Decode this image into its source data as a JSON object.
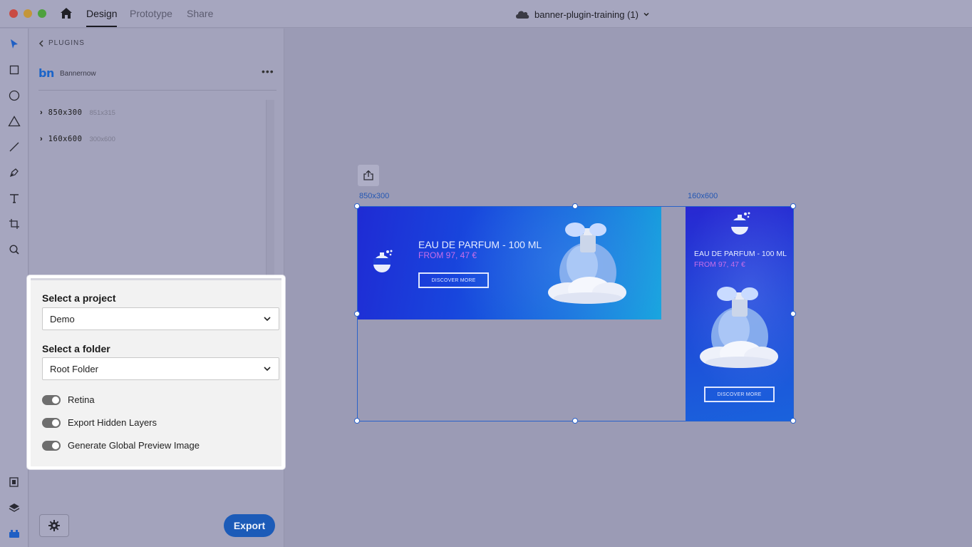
{
  "titlebar": {
    "tabs": [
      "Design",
      "Prototype",
      "Share"
    ],
    "active_tab": "Design",
    "document_title": "banner-plugin-training (1)"
  },
  "toolbar": {
    "tools": [
      "select-icon",
      "rectangle-icon",
      "ellipse-icon",
      "triangle-icon",
      "line-icon",
      "pen-icon",
      "text-icon",
      "artboard-icon",
      "zoom-icon",
      "document-assets-icon",
      "layers-icon",
      "plugins-icon"
    ]
  },
  "panel": {
    "back_label": "PLUGINS",
    "plugin_logo": "bn",
    "plugin_name": "Bannernow",
    "artboard_list": [
      {
        "name": "850x300",
        "detail": "851x315"
      },
      {
        "name": "160x600",
        "detail": "300x600"
      }
    ]
  },
  "export_settings": {
    "project_label": "Select a project",
    "project_value": "Demo",
    "folder_label": "Select a folder",
    "folder_value": "Root Folder",
    "toggles": [
      {
        "label": "Retina",
        "on": true
      },
      {
        "label": "Export Hidden Layers",
        "on": true
      },
      {
        "label": "Generate Global Preview Image",
        "on": true
      }
    ]
  },
  "footer": {
    "export_label": "Export"
  },
  "canvas": {
    "artboards": [
      {
        "label": "850x300",
        "title": "EAU DE PARFUM - 100 ML",
        "price": "FROM 97, 47 €",
        "button": "DISCOVER MORE"
      },
      {
        "label": "160x600",
        "title": "EAU DE PARFUM - 100 ML",
        "price": "FROM 97, 47 €",
        "button": "DISCOVER MORE"
      }
    ]
  },
  "colors": {
    "accent": "#1c5bb8",
    "selection": "#2a62c9",
    "price_text": "#c86ee8"
  }
}
